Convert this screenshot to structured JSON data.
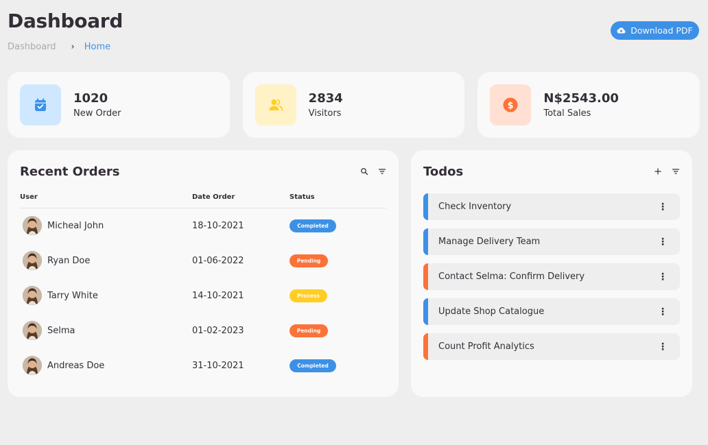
{
  "header": {
    "title": "Dashboard",
    "breadcrumb": [
      "Dashboard",
      "Home"
    ],
    "breadcrumb_separator": "›",
    "download_label": "Download PDF"
  },
  "stats": [
    {
      "value": "1020",
      "label": "New Order",
      "icon": "calendar-check-icon",
      "color": "#3c91e6"
    },
    {
      "value": "2834",
      "label": "Visitors",
      "icon": "people-icon",
      "color": "#ffce26"
    },
    {
      "value": "N$2543.00",
      "label": "Total Sales",
      "icon": "dollar-circle-icon",
      "color": "#fd7238"
    }
  ],
  "orders": {
    "title": "Recent Orders",
    "columns": [
      "User",
      "Date Order",
      "Status"
    ],
    "rows": [
      {
        "user": "Micheal John",
        "date": "18-10-2021",
        "status": "Completed"
      },
      {
        "user": "Ryan Doe",
        "date": "01-06-2022",
        "status": "Pending"
      },
      {
        "user": "Tarry White",
        "date": "14-10-2021",
        "status": "Process"
      },
      {
        "user": "Selma",
        "date": "01-02-2023",
        "status": "Pending"
      },
      {
        "user": "Andreas Doe",
        "date": "31-10-2021",
        "status": "Completed"
      }
    ]
  },
  "todos": {
    "title": "Todos",
    "items": [
      {
        "label": "Check Inventory",
        "accent": "blue"
      },
      {
        "label": "Manage Delivery Team",
        "accent": "blue"
      },
      {
        "label": "Contact Selma: Confirm Delivery",
        "accent": "orange"
      },
      {
        "label": "Update Shop Catalogue",
        "accent": "blue"
      },
      {
        "label": "Count Profit Analytics",
        "accent": "orange"
      }
    ],
    "more_glyph": "⋮"
  },
  "colors": {
    "blue": "#3c91e6",
    "yellow": "#ffce26",
    "orange": "#fd7238",
    "dark": "#342e37",
    "background": "#eeeeee",
    "card": "#f9f9f9"
  }
}
